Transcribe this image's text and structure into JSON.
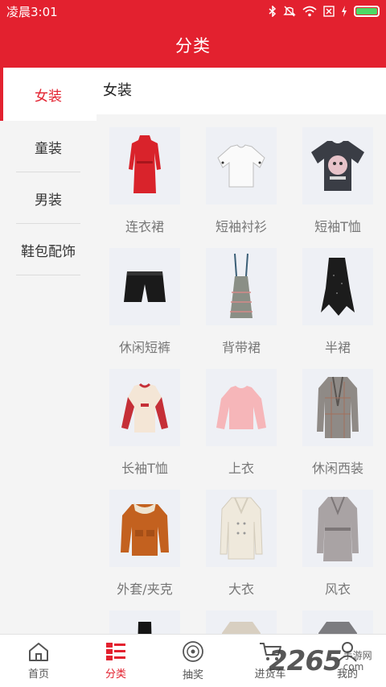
{
  "status_bar": {
    "time": "凌晨3:01",
    "battery_level": 1.0
  },
  "header": {
    "title": "分类"
  },
  "sidebar": {
    "items": [
      {
        "label": "女装",
        "active": true
      },
      {
        "label": "童装",
        "active": false
      },
      {
        "label": "男装",
        "active": false
      },
      {
        "label": "鞋包配饰",
        "active": false
      }
    ]
  },
  "main": {
    "section_title": "女装",
    "products": [
      {
        "label": "连衣裙",
        "icon": "red-dress-icon"
      },
      {
        "label": "短袖衬衫",
        "icon": "white-blouse-icon"
      },
      {
        "label": "短袖T恤",
        "icon": "dark-tshirt-icon"
      },
      {
        "label": "休闲短裤",
        "icon": "black-shorts-icon"
      },
      {
        "label": "背带裙",
        "icon": "pinafore-dress-icon"
      },
      {
        "label": "半裙",
        "icon": "black-skirt-icon"
      },
      {
        "label": "长袖T恤",
        "icon": "longsleeve-tshirt-icon"
      },
      {
        "label": "上衣",
        "icon": "pink-sweater-icon"
      },
      {
        "label": "休闲西装",
        "icon": "plaid-blazer-icon"
      },
      {
        "label": "外套/夹克",
        "icon": "orange-jacket-icon"
      },
      {
        "label": "大衣",
        "icon": "cream-coat-icon"
      },
      {
        "label": "风衣",
        "icon": "trench-coat-icon"
      },
      {
        "label": "",
        "icon": "partial-black-icon"
      },
      {
        "label": "",
        "icon": "partial-beige-icon"
      },
      {
        "label": "",
        "icon": "partial-grey-icon"
      }
    ]
  },
  "bottom_nav": {
    "items": [
      {
        "label": "首页",
        "icon": "home-icon",
        "active": false
      },
      {
        "label": "分类",
        "icon": "category-icon",
        "active": true
      },
      {
        "label": "抽奖",
        "icon": "lottery-icon",
        "active": false
      },
      {
        "label": "进货车",
        "icon": "cart-icon",
        "active": false
      },
      {
        "label": "我的",
        "icon": "user-icon",
        "active": false
      }
    ]
  },
  "watermark": {
    "big": "2265",
    "small_1": "手游网",
    "small_2": "com"
  },
  "colors": {
    "brand": "#e3212f",
    "sidebar_bg": "#f4f4f4",
    "thumb_bg": "#eef0f5"
  }
}
